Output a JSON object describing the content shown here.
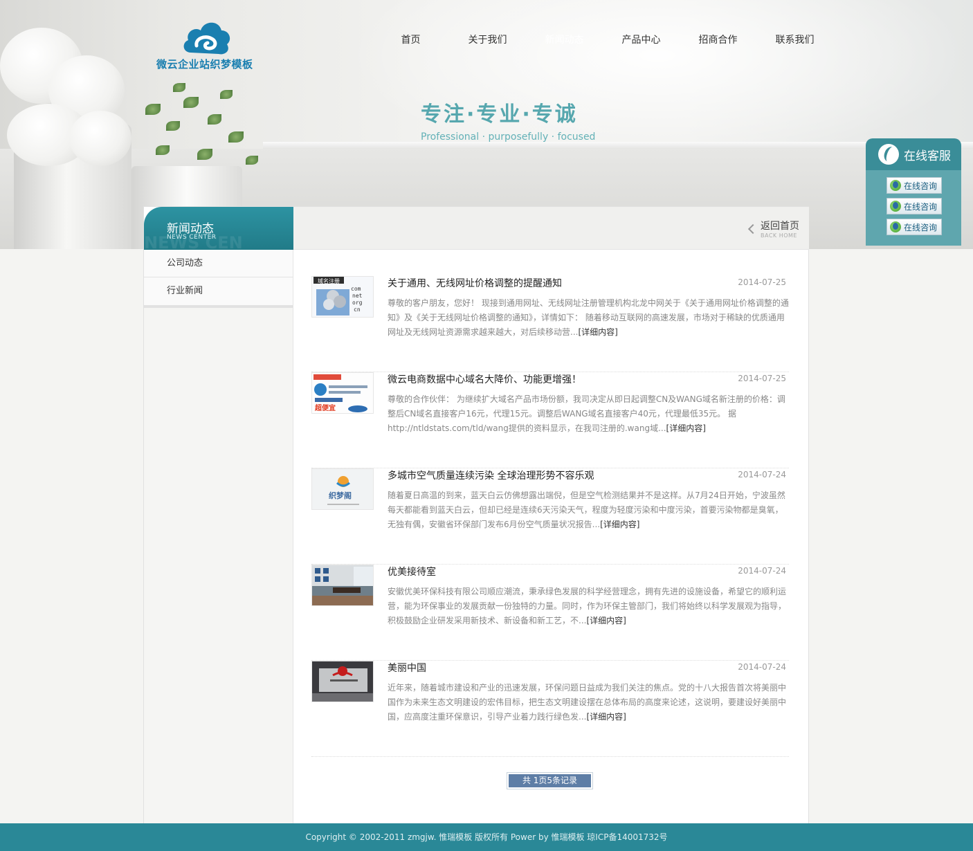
{
  "site": {
    "logo_text": "微云企业站织梦模板"
  },
  "nav": {
    "items": [
      {
        "label": "首页"
      },
      {
        "label": "关于我们"
      },
      {
        "label": "新闻动态",
        "active": true
      },
      {
        "label": "产品中心"
      },
      {
        "label": "招商合作"
      },
      {
        "label": "联系我们"
      }
    ]
  },
  "banner": {
    "slogan_cn": "专注·专业·专诚",
    "slogan_en": "Professional · purposefully · focused"
  },
  "service": {
    "title": "在线客服",
    "buttons": [
      "在线咨询",
      "在线咨询",
      "在线咨询"
    ]
  },
  "sidebar": {
    "title": "新闻动态",
    "subtitle": "NEWS CENTER",
    "watermark": "NEWS CEN",
    "items": [
      {
        "label": "公司动态"
      },
      {
        "label": "行业新闻"
      }
    ]
  },
  "crumb": {
    "back_label": "返回首页",
    "back_sub": "BACK HOME"
  },
  "news": [
    {
      "title": "关于通用、无线网址价格调整的提醒通知",
      "date": "2014-07-25",
      "summary": "尊敬的客户朋友，您好！ 现接到通用网址、无线网址注册管理机构北龙中网关于《关于通用网址价格调整的通知》及《关于无线网址价格调整的通知》，详情如下： 随着移动互联网的高速发展，市场对于稀缺的优质通用网址及无线网址资源需求越来越大，对后续移动营...",
      "more": "[详细内容]",
      "thumb_text": "域名注册"
    },
    {
      "title": "微云电商数据中心域名大降价、功能更增强！",
      "date": "2014-07-25",
      "summary": "尊敬的合作伙伴： 为继续扩大域名产品市场份额，我司决定从即日起调整CN及WANG域名新注册的价格：调整后CN域名直接客户16元，代理15元。调整后WANG域名直接客户40元，代理最低35元。 据 http://ntldstats.com/tld/wang提供的资料显示，在我司注册的.wang域...",
      "more": "[详细内容]",
      "thumb_text": "超便宜"
    },
    {
      "title": "多城市空气质量连续污染 全球治理形势不容乐观",
      "date": "2014-07-24",
      "summary": "随着夏日高温的到来，蓝天白云仿佛想露出端倪，但是空气检测结果并不是这样。从7月24日开始，宁波虽然每天都能看到蓝天白云，但却已经是连续6天污染天气，程度为轻度污染和中度污染，首要污染物都是臭氧，无独有偶，安徽省环保部门发布6月份空气质量状况报告...",
      "more": "[详细内容]",
      "thumb_text": "织梦阁"
    },
    {
      "title": "优美接待室",
      "date": "2014-07-24",
      "summary": "安徽优美环保科技有限公司顺应潮流，秉承绿色发展的科学经营理念，拥有先进的设施设备，希望它的顺利运营，能为环保事业的发展贡献一份独特的力量。同时，作为环保主管部门，我们将始终以科学发展观为指导，积极鼓励企业研发采用新技术、新设备和新工艺，不...",
      "more": "[详细内容]",
      "thumb_text": ""
    },
    {
      "title": "美丽中国",
      "date": "2014-07-24",
      "summary": "近年来，随着城市建设和产业的迅速发展，环保问题日益成为我们关注的焦点。党的十八大报告首次将美丽中国作为未来生态文明建设的宏伟目标，把生态文明建设摆在总体布局的高度来论述，这说明，要建设好美丽中国，应高度注重环保意识，引导产业着力践行绿色发...",
      "more": "[详细内容]",
      "thumb_text": ""
    }
  ],
  "pager": {
    "text": "共 1页5条记录"
  },
  "footer": {
    "text": "Copyright © 2002-2011 zmgjw. 惟瑞模板 版权所有 Power by 惟瑞模板 琼ICP备14001732号"
  },
  "colors": {
    "accent": "#2a8897",
    "nav_active": "#7fb8bd",
    "logo": "#1a7fb0",
    "pager": "#5e7ea6"
  }
}
